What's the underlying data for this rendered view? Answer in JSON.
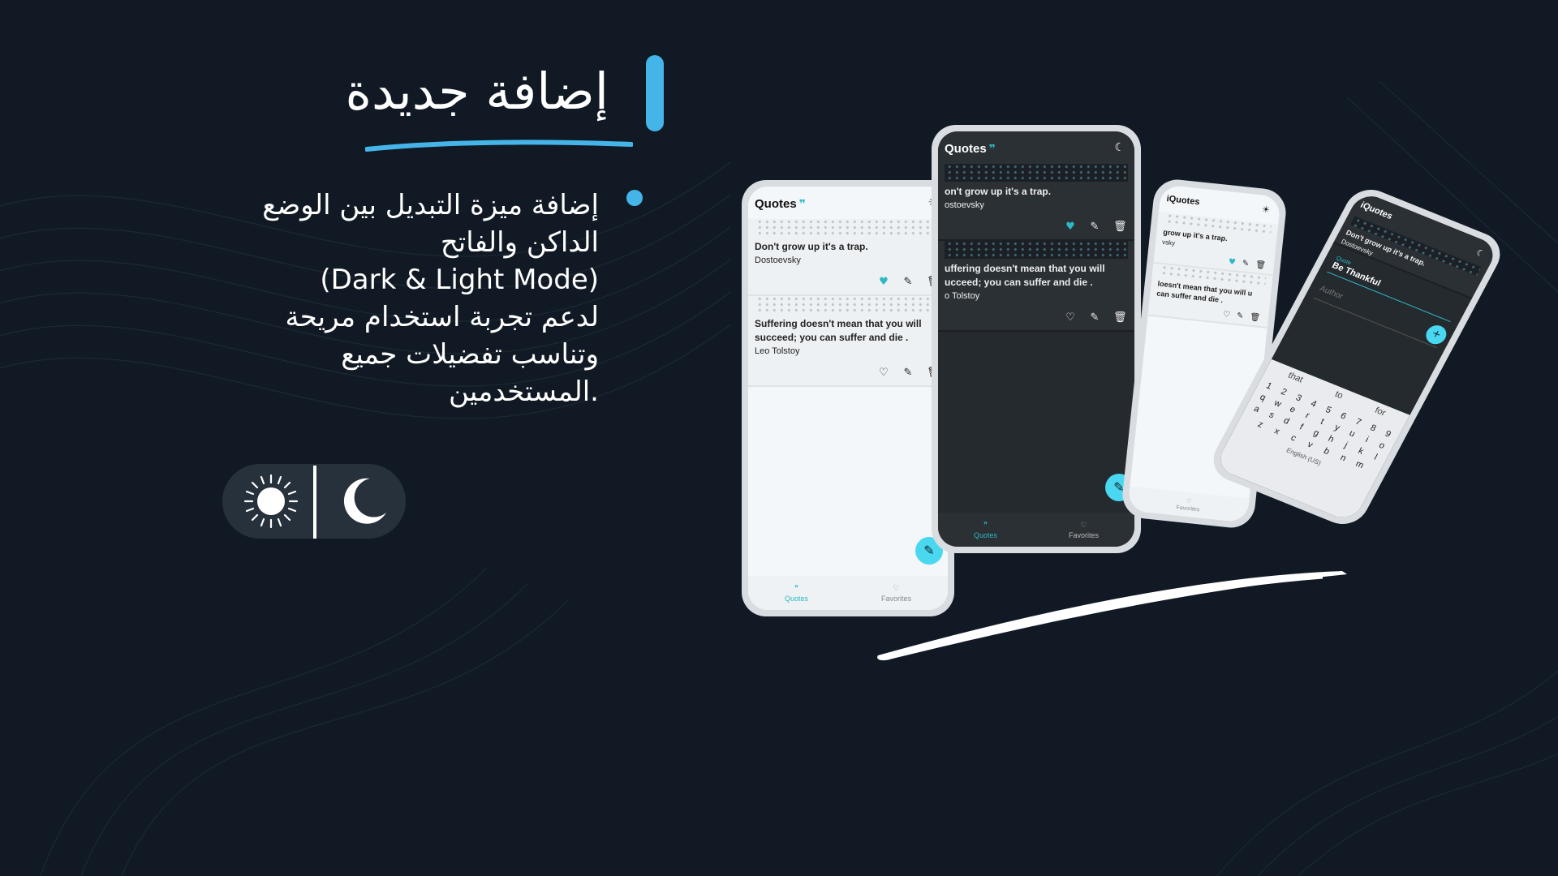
{
  "heading": {
    "title": "إضافة جديدة"
  },
  "feature": {
    "lines": [
      "إضافة ميزة التبديل بين الوضع",
      "الداكن والفاتح",
      "(Dark & Light Mode)",
      "لدعم تجربة استخدام مريحة",
      "وتناسب تفضيلات جميع",
      ".المستخدمين"
    ]
  },
  "toggle": {
    "sun_icon": "sun-icon",
    "moon_icon": "moon-icon"
  },
  "colors": {
    "background": "#111a24",
    "accent": "#45b4e9",
    "teal": "#2cb8c5",
    "fab": "#4ad7f0"
  },
  "app": {
    "title": "Quotes",
    "quote_mark": "❞",
    "nav": {
      "quotes": "Quotes",
      "favorites": "Favorites"
    },
    "quotes": [
      {
        "text": "Don't grow up it's a trap.",
        "author": "Dostoevsky",
        "favorite": true
      },
      {
        "text": "Suffering doesn't mean that you will succeed; you can suffer and die .",
        "author": "Leo Tolstoy",
        "favorite": false
      }
    ],
    "dark_quotes": [
      {
        "text": "on't grow up it's a trap.",
        "author": "ostoevsky"
      },
      {
        "text": "uffering doesn't mean that you will ucceed; you can suffer and die .",
        "author": "o Tolstoy"
      }
    ],
    "phone3": {
      "title": "iQuotes",
      "quotes": [
        {
          "text": "grow up it's a trap.",
          "author": "vsky"
        },
        {
          "text": "loesn't mean that you will u can suffer and die ."
        }
      ],
      "nav_label": "Favorites"
    },
    "phone4": {
      "title": "iQuotes",
      "quote": {
        "text": "Don't grow up it's a trap.",
        "author": "Dostoevsky"
      },
      "input_label": "Quote",
      "input_value": "Be Thankful",
      "author_placeholder": "Author",
      "keyboard": {
        "suggestions": [
          "that",
          "to",
          "for"
        ],
        "rows": [
          [
            "1",
            "2",
            "3",
            "4",
            "5",
            "6",
            "7",
            "8",
            "9"
          ],
          [
            "q",
            "w",
            "e",
            "r",
            "t",
            "y",
            "u",
            "i",
            "o"
          ],
          [
            "a",
            "s",
            "d",
            "f",
            "g",
            "h",
            "j",
            "k",
            "l"
          ],
          [
            "z",
            "x",
            "c",
            "v",
            "b",
            "n",
            "m"
          ]
        ],
        "language": "English (US)"
      }
    }
  }
}
